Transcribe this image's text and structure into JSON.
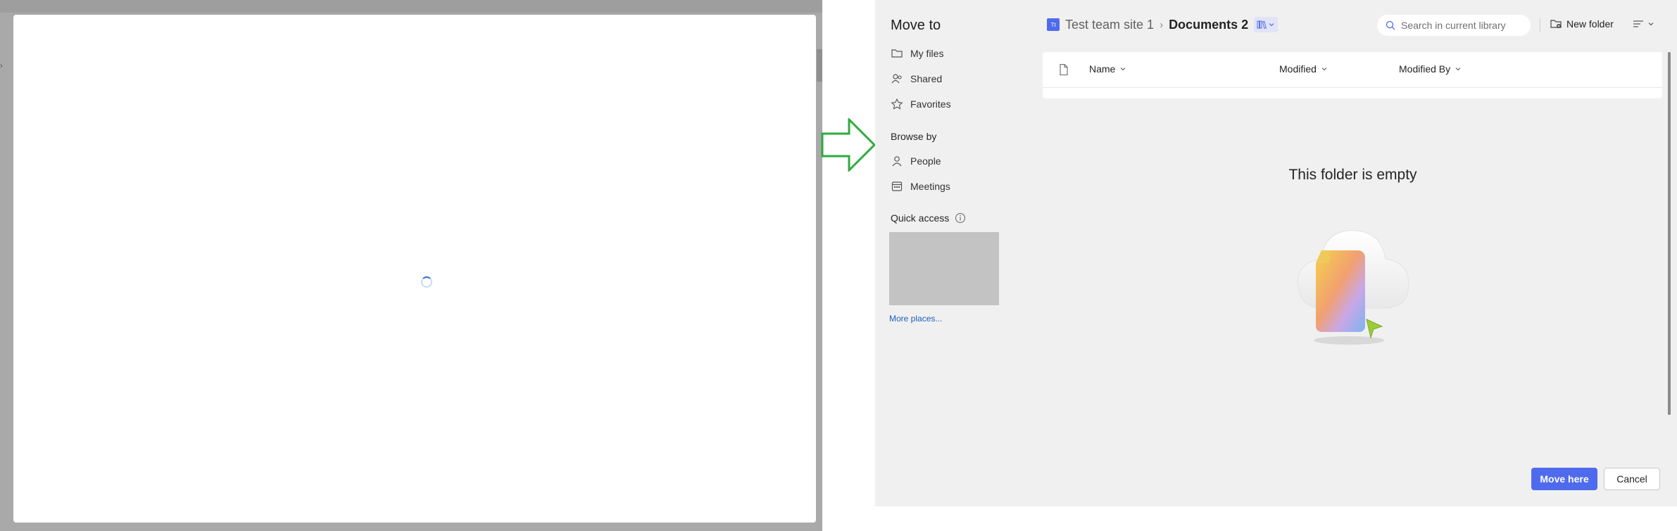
{
  "left_panel": {
    "loading_indicator": "spinner"
  },
  "dialog": {
    "title": "Move to",
    "nav": [
      {
        "label": "My files",
        "icon": "folder-icon"
      },
      {
        "label": "Shared",
        "icon": "people-icon"
      },
      {
        "label": "Favorites",
        "icon": "star-icon"
      }
    ],
    "browse_by": {
      "label": "Browse by",
      "items": [
        {
          "label": "People",
          "icon": "person-icon"
        },
        {
          "label": "Meetings",
          "icon": "calendar-icon"
        }
      ]
    },
    "quick_access": {
      "label": "Quick access",
      "more_link": "More places..."
    },
    "breadcrumb": {
      "site_initials": "Tt",
      "site": "Test team site 1",
      "current": "Documents 2"
    },
    "search": {
      "placeholder": "Search in current library"
    },
    "new_folder": "New folder",
    "columns": [
      "Name",
      "Modified",
      "Modified By"
    ],
    "empty_message": "This folder is empty",
    "buttons": {
      "primary": "Move here",
      "secondary": "Cancel"
    },
    "colors": {
      "accent": "#4f6bed",
      "arrow": "#2eab3f"
    }
  }
}
